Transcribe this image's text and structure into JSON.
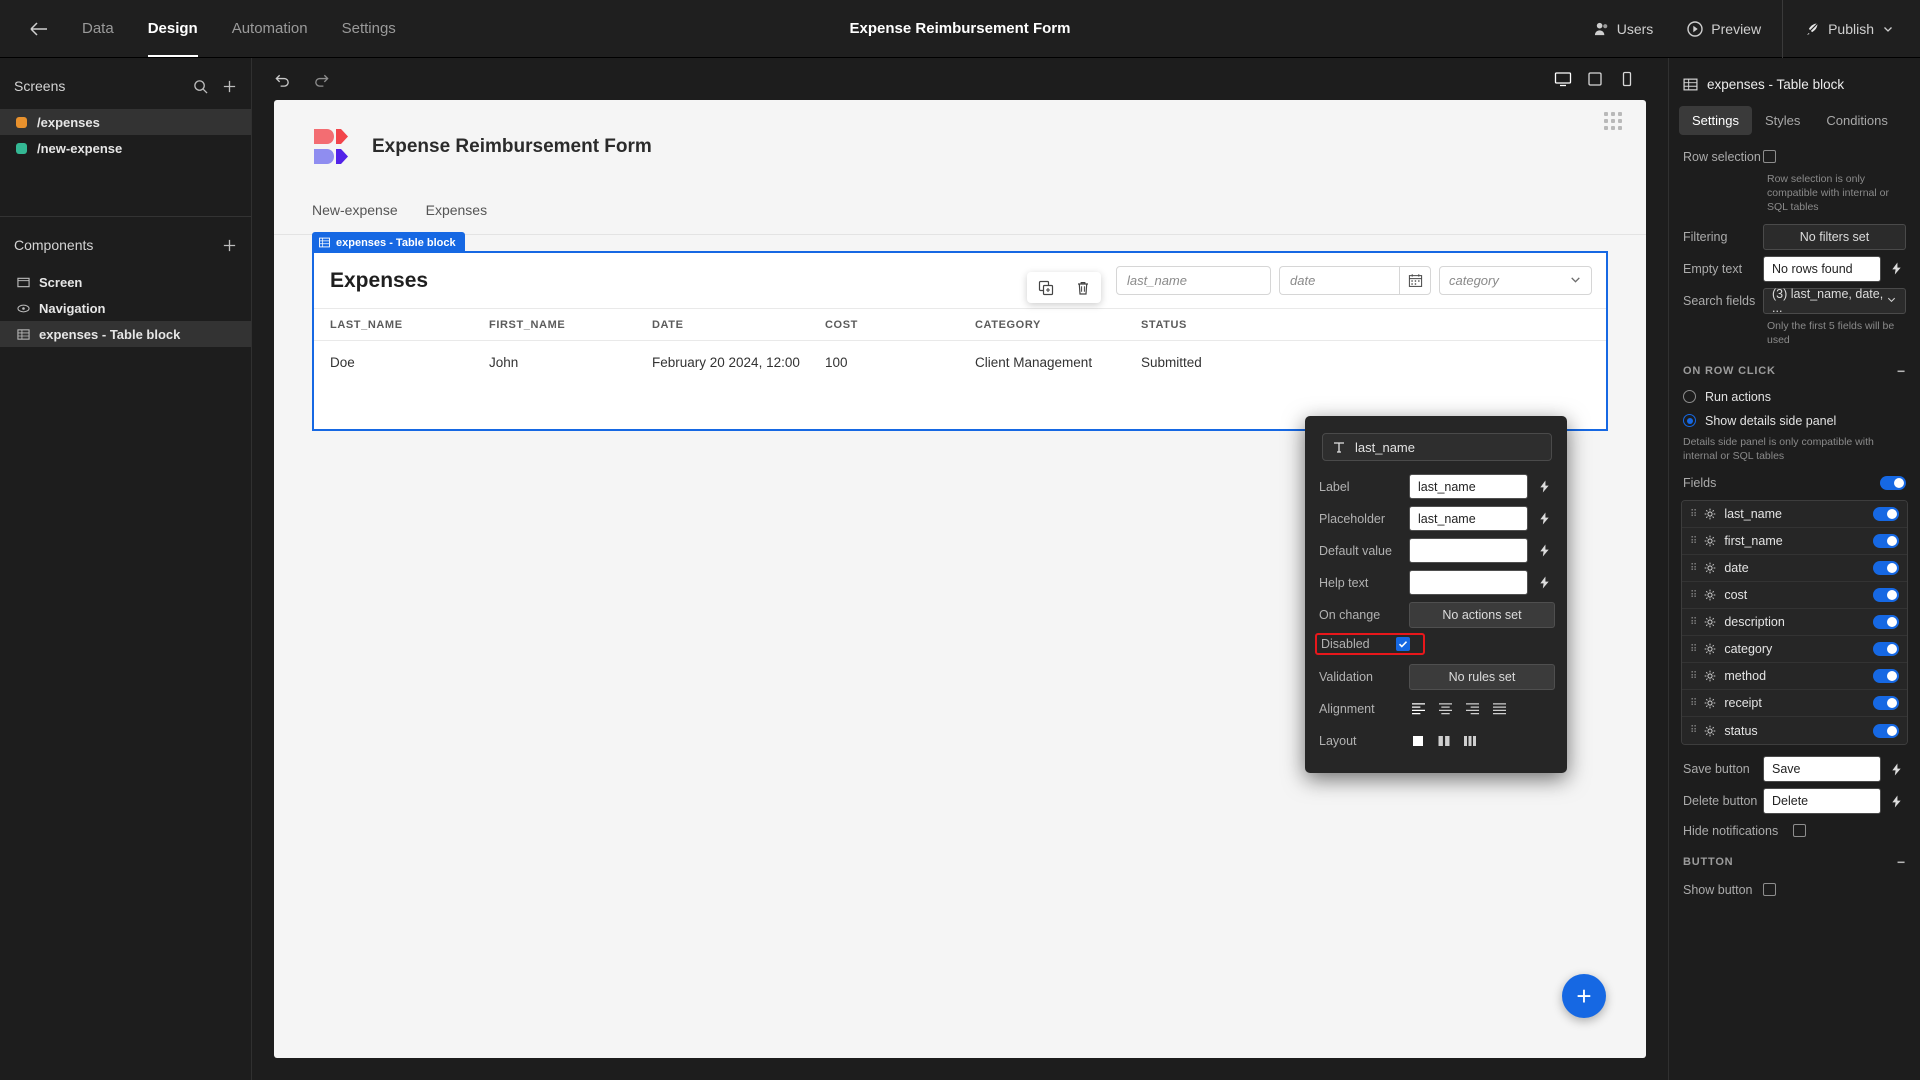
{
  "topbar": {
    "back_icon": "arrow-left-icon",
    "tabs": [
      {
        "label": "Data",
        "active": false
      },
      {
        "label": "Design",
        "active": true
      },
      {
        "label": "Automation",
        "active": false
      },
      {
        "label": "Settings",
        "active": false
      }
    ],
    "title": "Expense Reimbursement Form",
    "users_label": "Users",
    "preview_label": "Preview",
    "publish_label": "Publish"
  },
  "left_panel": {
    "screens_title": "Screens",
    "screens": [
      {
        "label": "/expenses",
        "color": "#e8912d",
        "selected": true
      },
      {
        "label": "/new-expense",
        "color": "#34b894",
        "selected": false
      }
    ],
    "components_title": "Components",
    "components": [
      {
        "label": "Screen",
        "icon": "screen-icon",
        "selected": false
      },
      {
        "label": "Navigation",
        "icon": "navigation-icon",
        "selected": false
      },
      {
        "label": "expenses - Table block",
        "icon": "table-icon",
        "selected": true
      }
    ]
  },
  "canvas": {
    "app_title": "Expense Reimbursement Form",
    "tabs": [
      "New-expense",
      "Expenses"
    ],
    "block_tag": "expenses - Table block",
    "table": {
      "title": "Expenses",
      "filters": {
        "last_name_placeholder": "last_name",
        "date_placeholder": "date",
        "category_placeholder": "category"
      },
      "columns": [
        "LAST_NAME",
        "FIRST_NAME",
        "DATE",
        "COST",
        "CATEGORY",
        "STATUS"
      ],
      "rows": [
        {
          "last_name": "Doe",
          "first_name": "John",
          "date": "February 20 2024, 12:00",
          "cost": "100",
          "category": "Client Management",
          "status": "Submitted"
        }
      ]
    },
    "fab_label": "+"
  },
  "popup": {
    "field_name": "last_name",
    "field_icon": "text-field-icon",
    "rows": [
      {
        "label": "Label",
        "value": "last_name",
        "type": "input"
      },
      {
        "label": "Placeholder",
        "value": "last_name",
        "type": "input"
      },
      {
        "label": "Default value",
        "value": "",
        "type": "input"
      },
      {
        "label": "Help text",
        "value": "",
        "type": "input"
      },
      {
        "label": "On change",
        "value": "No actions set",
        "type": "button"
      }
    ],
    "disabled_label": "Disabled",
    "disabled_checked": true,
    "validation_label": "Validation",
    "validation_value": "No rules set",
    "alignment_label": "Alignment",
    "alignment_options": [
      "align-left-icon",
      "align-center-icon",
      "align-right-icon",
      "align-justify-icon"
    ],
    "alignment_selected": 0,
    "layout_label": "Layout",
    "layout_options": [
      "layout-single-icon",
      "layout-two-col-icon",
      "layout-three-col-icon"
    ],
    "layout_selected": 0,
    "highlight_color": "#e8171b"
  },
  "right_panel": {
    "header_title": "expenses - Table block",
    "header_icon": "table-icon",
    "tabs": [
      {
        "label": "Settings",
        "active": true
      },
      {
        "label": "Styles",
        "active": false
      },
      {
        "label": "Conditions",
        "active": false
      }
    ],
    "row_selection_label": "Row selection",
    "row_selection_hint": "Row selection is only compatible with internal or SQL tables",
    "filtering_label": "Filtering",
    "filtering_value": "No filters set",
    "empty_text_label": "Empty text",
    "empty_text_value": "No rows found",
    "search_fields_label": "Search fields",
    "search_fields_value": "(3) last_name, date, ...",
    "search_fields_hint": "Only the first 5 fields will be used",
    "on_row_click_title": "ON ROW CLICK",
    "run_actions_label": "Run actions",
    "show_details_label": "Show details side panel",
    "details_hint": "Details side panel is only compatible with internal or SQL tables",
    "fields_label": "Fields",
    "fields": [
      {
        "name": "last_name",
        "enabled": true
      },
      {
        "name": "first_name",
        "enabled": true
      },
      {
        "name": "date",
        "enabled": true
      },
      {
        "name": "cost",
        "enabled": true
      },
      {
        "name": "description",
        "enabled": true
      },
      {
        "name": "category",
        "enabled": true
      },
      {
        "name": "method",
        "enabled": true
      },
      {
        "name": "receipt",
        "enabled": true
      },
      {
        "name": "status",
        "enabled": true
      }
    ],
    "save_button_label": "Save button",
    "save_button_value": "Save",
    "delete_button_label": "Delete button",
    "delete_button_value": "Delete",
    "hide_notifications_label": "Hide notifications",
    "button_section_title": "BUTTON",
    "show_button_label": "Show button"
  }
}
